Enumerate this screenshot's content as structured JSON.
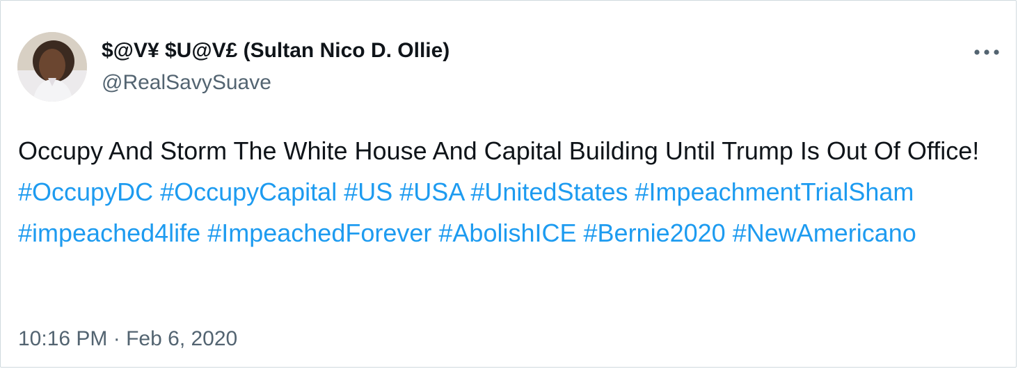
{
  "tweet": {
    "author": {
      "display_name": "$@V¥ $U@V£ (Sultan Nico D. Ollie)",
      "handle": "@RealSavySuave",
      "avatar_icon": "profile-photo"
    },
    "more_icon": "more-options-icon",
    "text": "Occupy And Storm The White House And Capital Building Until Trump Is Out Of Office!",
    "hashtags": [
      "#OccupyDC",
      "#OccupyCapital",
      "#US",
      "#USA",
      "#UnitedStates",
      "#ImpeachmentTrialSham",
      "#impeached4life",
      "#ImpeachedForever",
      "#AbolishICE",
      "#Bernie2020",
      "#NewAmericano"
    ],
    "time": "10:16 PM",
    "separator": "·",
    "date": "Feb 6, 2020"
  },
  "colors": {
    "text": "#0f1419",
    "secondary": "#536471",
    "link": "#1d9bf0",
    "border": "#cfd9de"
  }
}
